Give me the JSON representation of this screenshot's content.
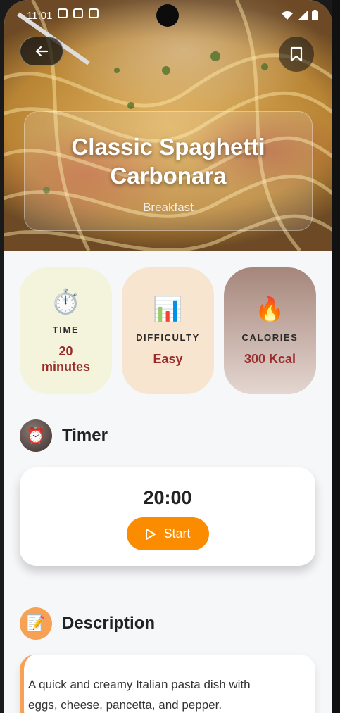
{
  "status_bar": {
    "time": "11:01"
  },
  "hero": {
    "title": "Classic Spaghetti Carbonara",
    "category": "Breakfast"
  },
  "info_cards": [
    {
      "icon": "⏱️",
      "icon_name": "stopwatch-icon",
      "label": "TIME",
      "value": "20 minutes"
    },
    {
      "icon": "📊",
      "icon_name": "bar-chart-icon",
      "label": "DIFFICULTY",
      "value": "Easy"
    },
    {
      "icon": "🔥",
      "icon_name": "fire-icon",
      "label": "CALORIES",
      "value": "300 Kcal"
    }
  ],
  "timer": {
    "section_icon": "⏰",
    "title": "Timer",
    "value": "20:00",
    "start_label": "Start"
  },
  "description": {
    "section_icon": "📝",
    "title": "Description",
    "text": "A quick and creamy Italian pasta dish with eggs, cheese, pancetta, and pepper."
  },
  "colors": {
    "accent": "#fb8c00",
    "value_text": "#9a2b2b",
    "card_time": "#f4f4dc",
    "card_difficulty": "#f7e5cf",
    "card_calories": "#a5867b"
  }
}
